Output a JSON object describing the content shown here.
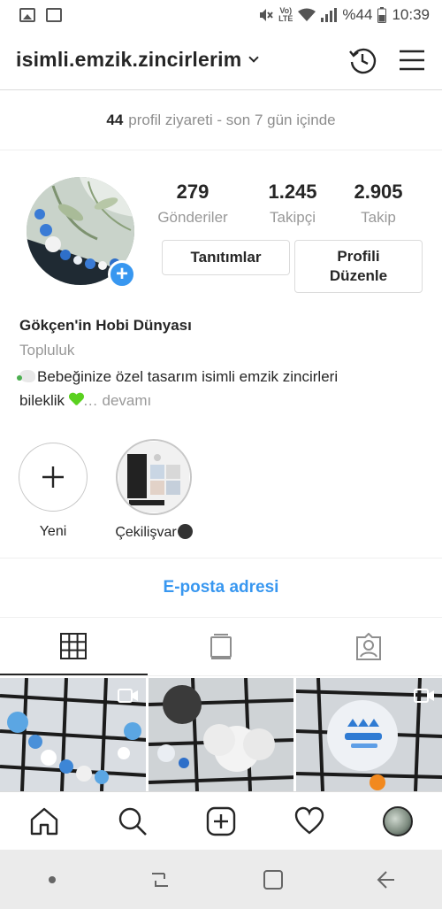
{
  "status_bar": {
    "volte_top": "Vo)",
    "volte_bottom": "LTE",
    "battery": "%44",
    "time": "10:39"
  },
  "header": {
    "username": "isimli.emzik.zincirlerim",
    "icons": [
      "history-icon",
      "menu-icon"
    ]
  },
  "insights": {
    "count": "44",
    "text": "profil ziyareti - son 7 gün içinde"
  },
  "profile": {
    "stats": [
      {
        "value": "279",
        "label": "Gönderiler"
      },
      {
        "value": "1.245",
        "label": "Takipçi"
      },
      {
        "value": "2.905",
        "label": "Takip"
      }
    ],
    "buttons": {
      "promotions": "Tanıtımlar",
      "edit_line1": "Profili",
      "edit_line2": "Düzenle"
    },
    "name": "Gökçen'in Hobi Dünyası",
    "category": "Topluluk",
    "bio_line1": "Bebeğinize özel tasarım isimli emzik zincirleri",
    "bio_line2": "bileklik",
    "more": "… devamı"
  },
  "highlights": [
    {
      "label": "Yeni"
    },
    {
      "label": "Çekilişvar"
    }
  ],
  "email_button": "E-posta adresi",
  "tabs": [
    "grid-icon",
    "tv-icon",
    "tagged-icon"
  ],
  "bottom_nav": [
    "home-icon",
    "search-icon",
    "add-post-icon",
    "heart-icon",
    "profile-avatar"
  ],
  "colors": {
    "accent": "#3897f0",
    "text": "#262626",
    "muted": "#8e8e8e",
    "border": "#dbdbdb"
  }
}
